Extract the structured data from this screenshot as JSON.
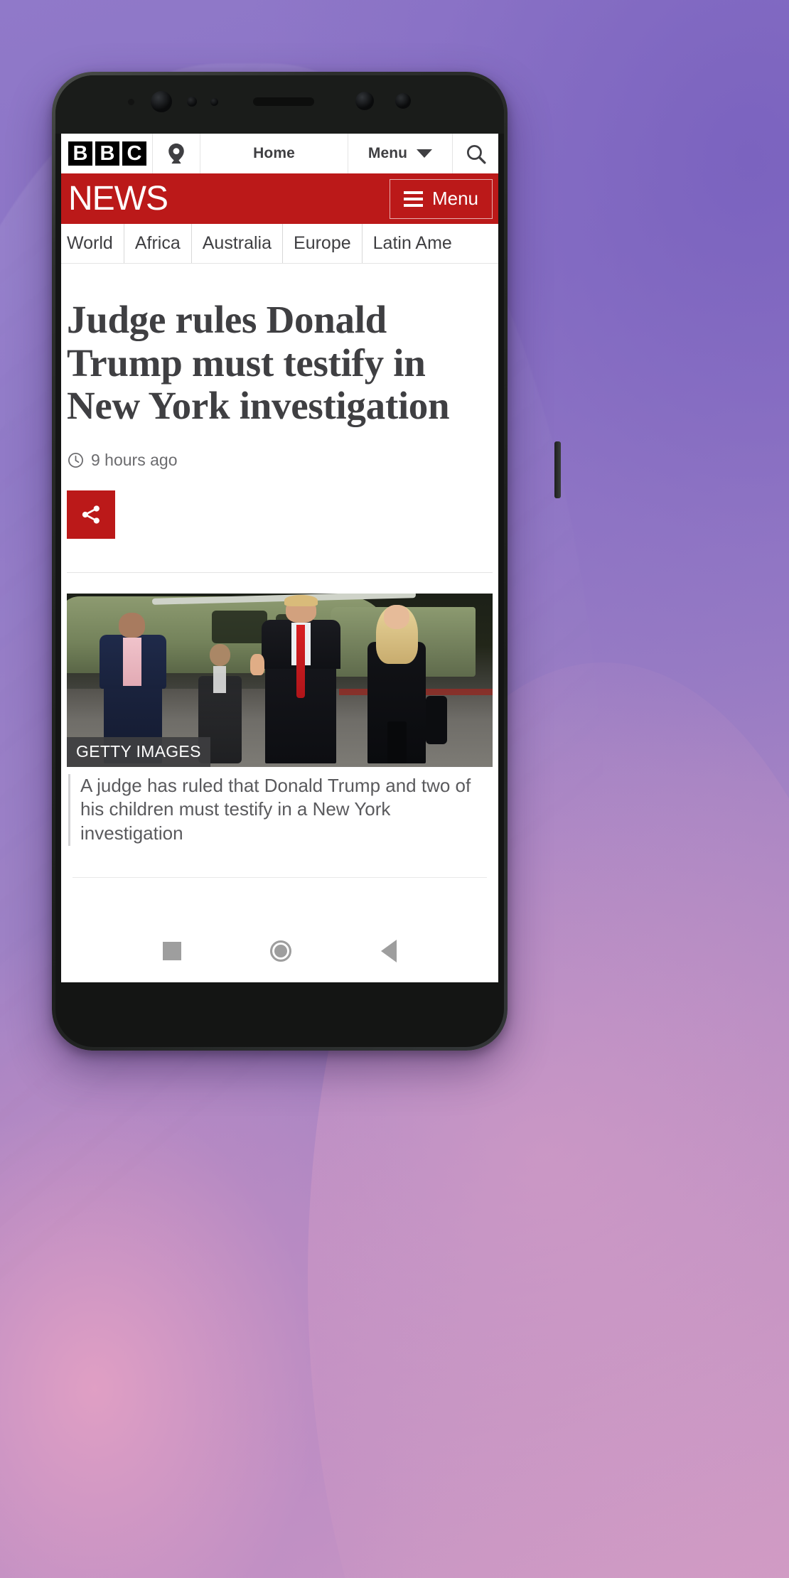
{
  "device": {
    "platform": "android-phone",
    "sensors": [
      "ir-sensor-icon",
      "front-camera-icon",
      "proximity-sensor-icon",
      "light-sensor-icon",
      "earpiece-speaker",
      "front-camera-2-icon",
      "front-camera-3-icon"
    ]
  },
  "bbc_nav": {
    "logo_letters": [
      "B",
      "B",
      "C"
    ],
    "account_icon": "account-icon",
    "home_label": "Home",
    "menu_label": "Menu",
    "menu_caret_icon": "chevron-down-icon",
    "search_icon": "search-icon"
  },
  "masthead": {
    "wordmark": "NEWS",
    "menu_label": "Menu",
    "menu_icon": "hamburger-icon",
    "background_color": "#bb1919"
  },
  "section_nav": {
    "tabs": [
      {
        "label": "World"
      },
      {
        "label": "Africa"
      },
      {
        "label": "Australia"
      },
      {
        "label": "Europe"
      },
      {
        "label": "Latin Ame"
      }
    ]
  },
  "article": {
    "headline": "Judge rules Donald Trump must testify in New York investigation",
    "timestamp": "9 hours ago",
    "clock_icon": "clock-icon",
    "share_icon": "share-icon",
    "share_button_color": "#bb1919",
    "photo": {
      "credit": "GETTY IMAGES",
      "alt": "Donald Trump Jr, Donald Trump and Ivanka Trump walking on a tarmac in front of a helicopter at night"
    },
    "caption": "A judge has ruled that Donald Trump and two of his children must testify in a New York investigation"
  },
  "system_nav": {
    "recent_label": "recent-apps",
    "home_label": "home",
    "back_label": "back"
  }
}
